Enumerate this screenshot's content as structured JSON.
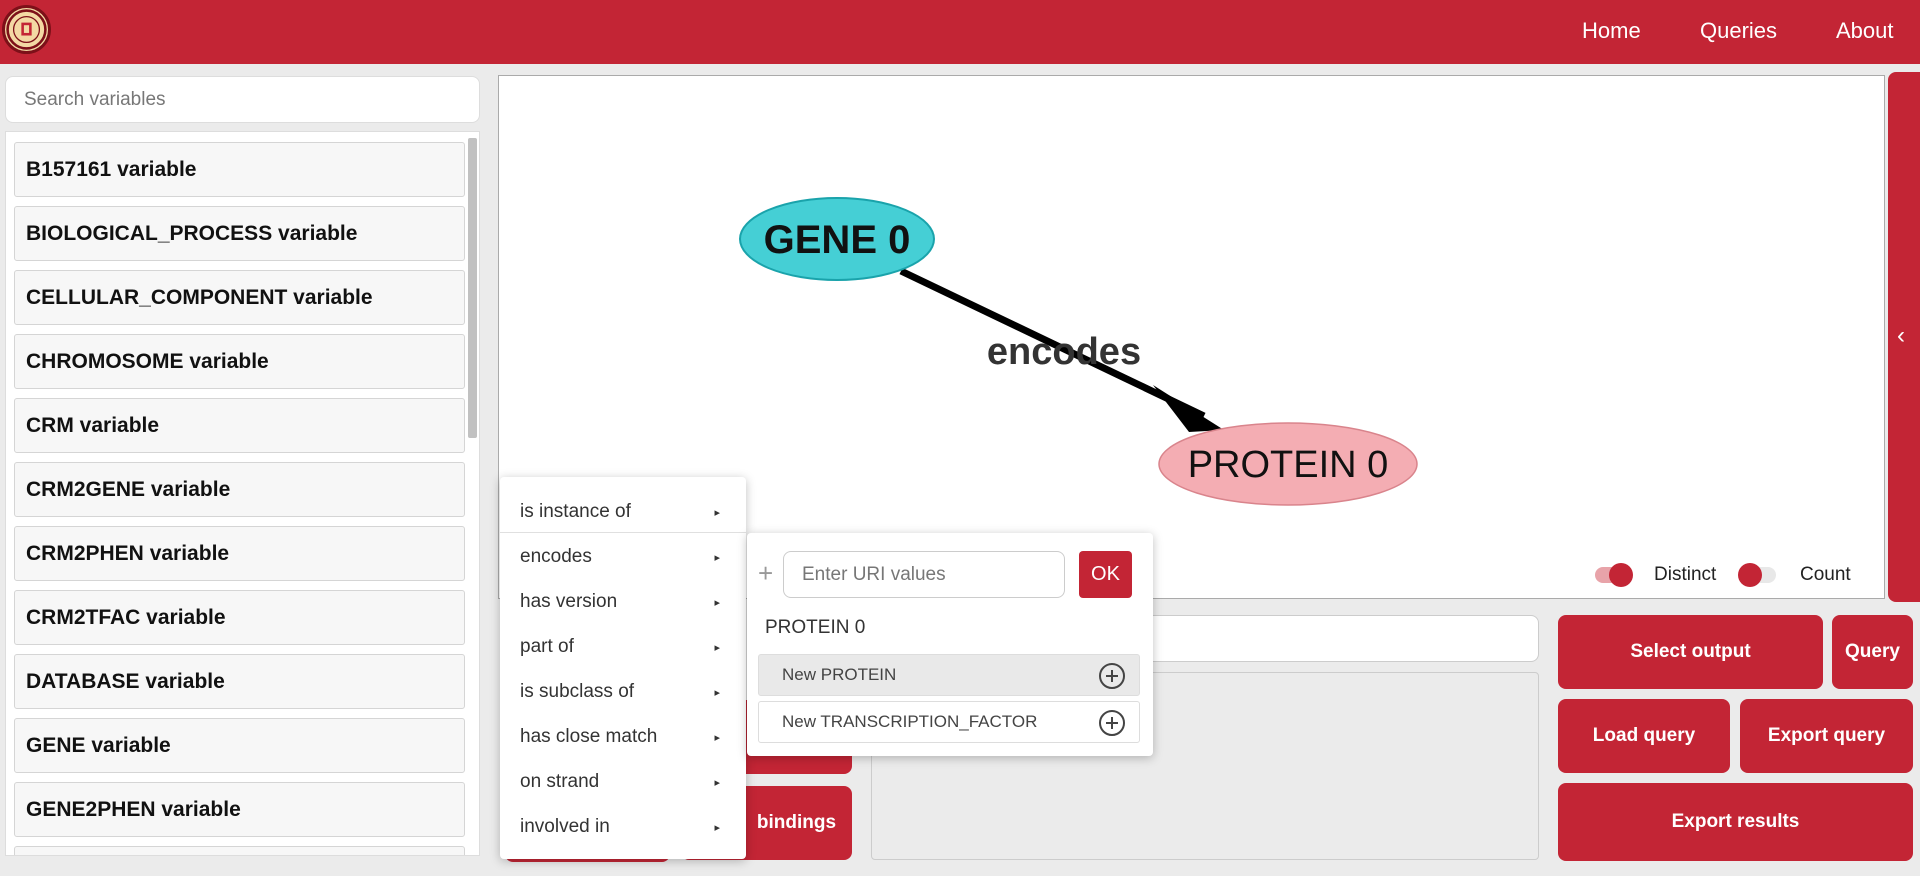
{
  "nav": {
    "logo_icon": "university-seal-logo",
    "links": [
      "Home",
      "Queries",
      "About"
    ]
  },
  "sidebar": {
    "search_placeholder": "Search variables",
    "variables": [
      {
        "name": "B157161",
        "suffix": " variable"
      },
      {
        "name": "BIOLOGICAL_PROCESS",
        "suffix": " variable"
      },
      {
        "name": "CELLULAR_COMPONENT",
        "suffix": " variable"
      },
      {
        "name": "CHROMOSOME",
        "suffix": " variable"
      },
      {
        "name": "CRM",
        "suffix": " variable"
      },
      {
        "name": "CRM2GENE",
        "suffix": " variable"
      },
      {
        "name": "CRM2PHEN",
        "suffix": " variable"
      },
      {
        "name": "CRM2TFAC",
        "suffix": " variable"
      },
      {
        "name": "DATABASE",
        "suffix": " variable"
      },
      {
        "name": "GENE",
        "suffix": " variable"
      },
      {
        "name": "GENE2PHEN",
        "suffix": " variable"
      }
    ]
  },
  "graph": {
    "nodes": {
      "gene": {
        "label": "GENE 0",
        "color": "#45cfd5"
      },
      "protein": {
        "label": "PROTEIN 0",
        "color": "#f4adb3"
      }
    },
    "edge_label": "encodes",
    "toggles": {
      "distinct": {
        "label": "Distinct",
        "on": true
      },
      "count": {
        "label": "Count",
        "on": false
      }
    },
    "collapse_icon": "chevron-left-icon"
  },
  "buttons": {
    "select_output": "Select output",
    "query": "Query",
    "load_query": "Load query",
    "export_query": "Export query",
    "export_results": "Export results",
    "bindings": "bindings"
  },
  "context_menu": {
    "items": [
      "is instance of",
      "encodes",
      "has version",
      "part of",
      "is subclass of",
      "has close match",
      "on strand",
      "involved in"
    ]
  },
  "submenu": {
    "uri_placeholder": "Enter URI values",
    "ok_label": "OK",
    "existing_node": "PROTEIN 0",
    "new_options": [
      "New PROTEIN",
      "New TRANSCRIPTION_FACTOR"
    ]
  },
  "colors": {
    "brand": "#c32535"
  }
}
